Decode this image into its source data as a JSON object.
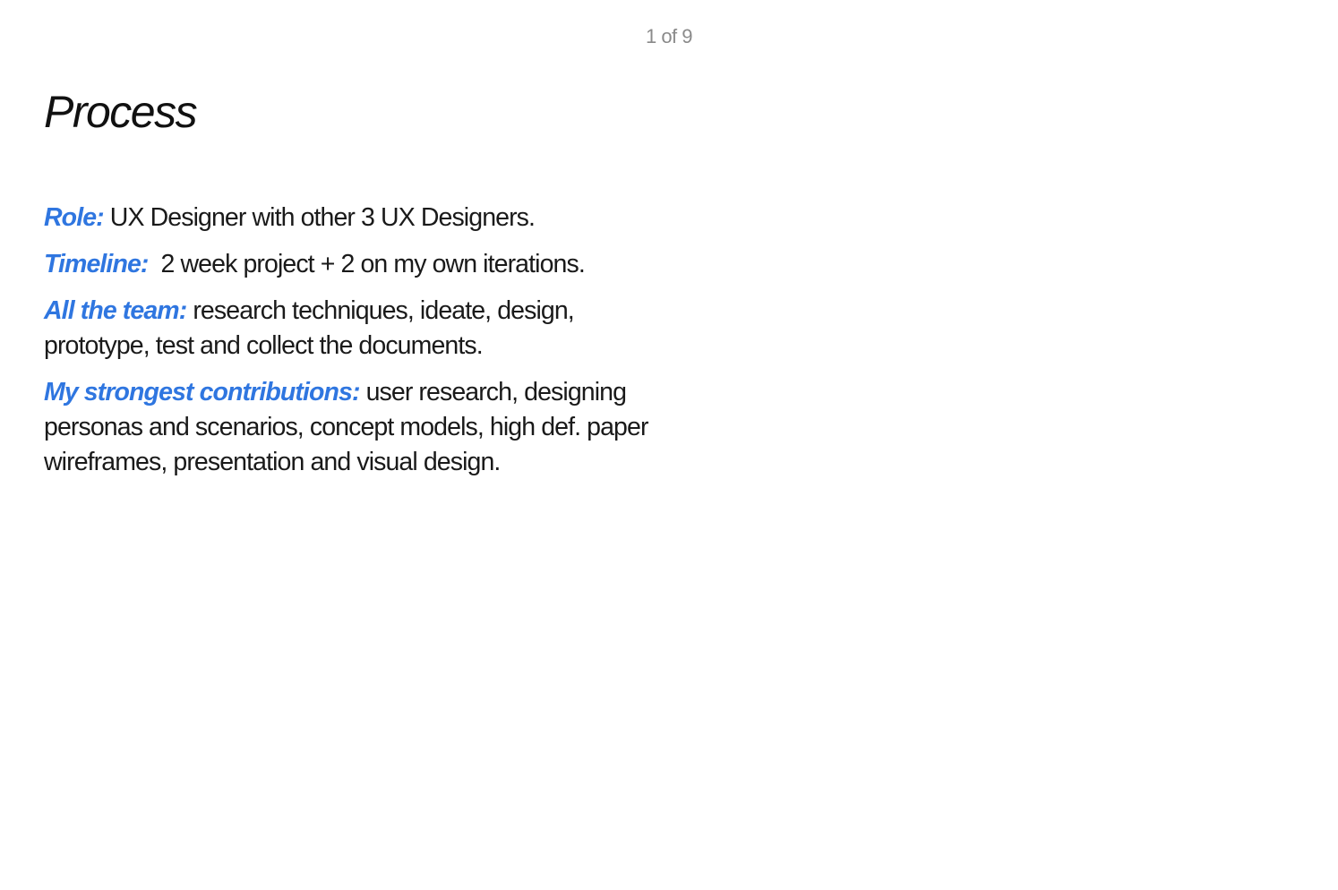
{
  "page": {
    "counter": "1 of 9",
    "title": "Process"
  },
  "colors": {
    "accent": "#2f76e0",
    "text": "#1a1a1a",
    "counter": "#8a8a8a"
  },
  "entries": [
    {
      "label": "Role:",
      "text": " UX Designer with other 3 UX Designers."
    },
    {
      "label": "Timeline:",
      "text": "  2 week project + 2 on my own iterations."
    },
    {
      "label": "All the team:",
      "text": " research techniques, ideate, design, prototype, test and collect the documents."
    },
    {
      "label": "My strongest contributions:",
      "text": " user research, designing personas and scenarios, concept models, high def. paper wireframes, presentation and visual design."
    }
  ]
}
